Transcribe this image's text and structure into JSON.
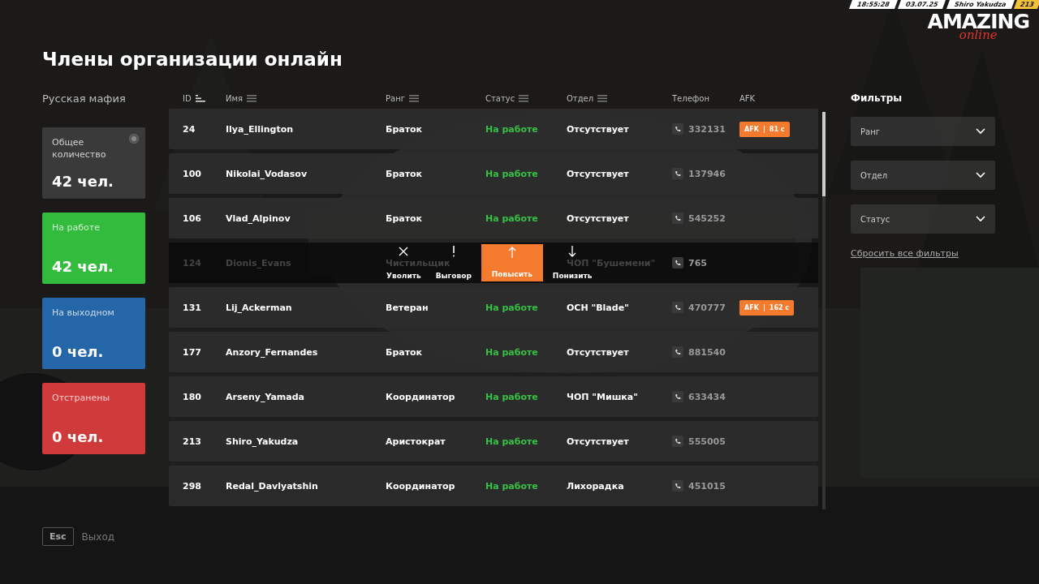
{
  "hud": {
    "time": "18:55:28",
    "date": "03.07.25",
    "player": "Shiro Yakudza",
    "player_id": "213"
  },
  "logo": {
    "title": "AMAZING",
    "subtitle": "online"
  },
  "title": "Члены организации онлайн",
  "organization": "Русская мафия",
  "stats": [
    {
      "kind": "total",
      "label": "Общее количество",
      "value": "42 чел."
    },
    {
      "kind": "working",
      "label": "На работе",
      "value": "42 чел."
    },
    {
      "kind": "off",
      "label": "На выходном",
      "value": "0 чел."
    },
    {
      "kind": "suspended",
      "label": "Отстранены",
      "value": "0 чел."
    }
  ],
  "table": {
    "columns": [
      {
        "label": "ID",
        "kind": "sorted"
      },
      {
        "label": "Имя",
        "kind": "sortable"
      },
      {
        "label": "Ранг",
        "kind": "sortable"
      },
      {
        "label": "Статус",
        "kind": "sortable"
      },
      {
        "label": "Отдел",
        "kind": "sortable"
      },
      {
        "label": "Телефон",
        "kind": "plain"
      },
      {
        "label": "AFK",
        "kind": "plain"
      }
    ],
    "rows": [
      {
        "id": "24",
        "name": "Ilya_Ellington",
        "rank": "Браток",
        "status": "На работе",
        "department": "Отсутствует",
        "phone": "332131",
        "afk": {
          "label": "AFK",
          "time": "81 с"
        },
        "menu_open": false
      },
      {
        "id": "100",
        "name": "Nikolai_Vodasov",
        "rank": "Браток",
        "status": "На работе",
        "department": "Отсутствует",
        "phone": "137946",
        "menu_open": false
      },
      {
        "id": "106",
        "name": "Vlad_Alpinov",
        "rank": "Браток",
        "status": "На работе",
        "department": "Отсутствует",
        "phone": "545252",
        "menu_open": false
      },
      {
        "id": "124",
        "name": "Dionis_Evans",
        "rank": "Чистильщик",
        "department": "ЧОП \"Бушемени\"",
        "phone": "765",
        "menu_open": true
      },
      {
        "id": "131",
        "name": "Lij_Ackerman",
        "rank": "Ветеран",
        "status": "На работе",
        "department": "ОСН \"Blade\"",
        "phone": "470777",
        "afk": {
          "label": "AFK",
          "time": "162 с"
        },
        "menu_open": false
      },
      {
        "id": "177",
        "name": "Anzory_Fernandes",
        "rank": "Браток",
        "status": "На работе",
        "department": "Отсутствует",
        "phone": "881540",
        "menu_open": false
      },
      {
        "id": "180",
        "name": "Arseny_Yamada",
        "rank": "Координатор",
        "status": "На работе",
        "department": "ЧОП \"Мишка\"",
        "phone": "633434",
        "menu_open": false
      },
      {
        "id": "213",
        "name": "Shiro_Yakudza",
        "rank": "Аристократ",
        "status": "На работе",
        "department": "Отсутствует",
        "phone": "555005",
        "menu_open": false
      },
      {
        "id": "298",
        "name": "Redal_Davlyatshin",
        "rank": "Координатор",
        "status": "На работе",
        "department": "Лихорадка",
        "phone": "451015",
        "menu_open": false
      }
    ]
  },
  "row_actions": [
    {
      "kind": "fire",
      "label": "Уволить",
      "selected": false
    },
    {
      "kind": "warn",
      "label": "Выговор",
      "selected": false
    },
    {
      "kind": "promote",
      "label": "Повысить",
      "selected": true
    },
    {
      "kind": "demote",
      "label": "Понизить",
      "selected": false
    }
  ],
  "filters": {
    "title": "Фильтры",
    "selects": [
      {
        "label": "Ранг"
      },
      {
        "label": "Отдел"
      },
      {
        "label": "Статус"
      }
    ],
    "reset": "Сбросить все фильтры"
  },
  "exit": {
    "key": "Esc",
    "label": "Выход"
  }
}
